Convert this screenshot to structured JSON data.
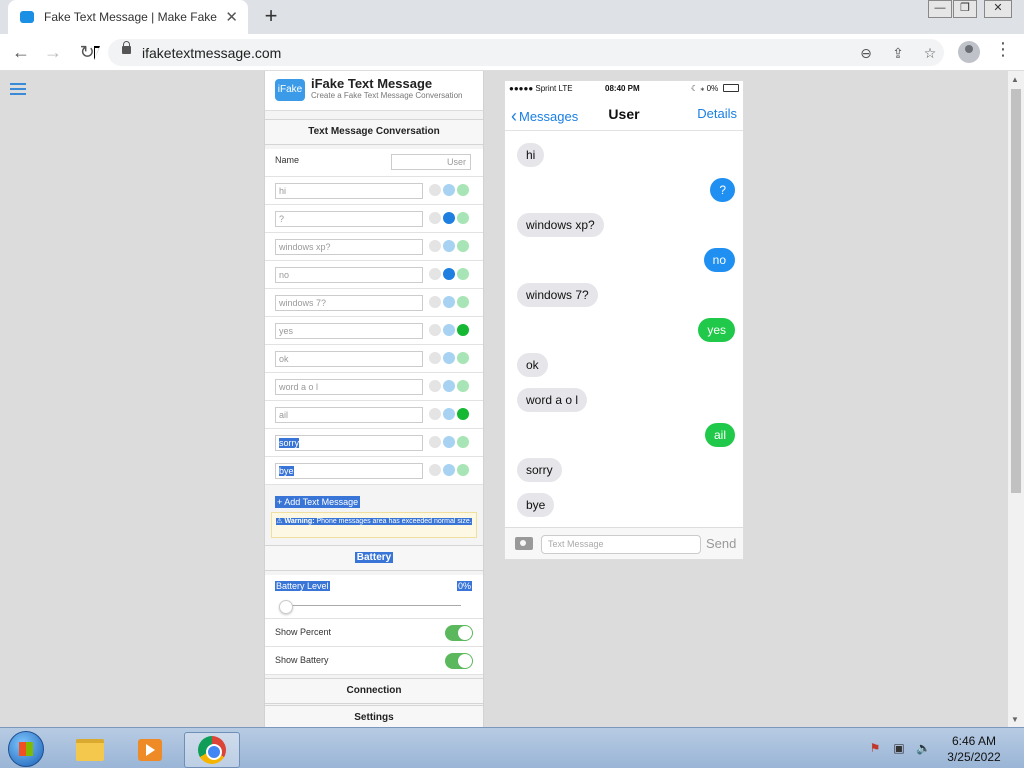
{
  "browser": {
    "tab_title": "Fake Text Message | Make Fake Te",
    "new_tab_label": "+",
    "url": "ifaketextmessage.com"
  },
  "sidebar": {
    "logo_text": "iFake",
    "brand_title": "iFake Text Message",
    "brand_subtitle": "Create a Fake Text Message Conversation",
    "conversation_header": "Text Message Conversation",
    "name_label": "Name",
    "name_value": "User",
    "messages": [
      {
        "text": "hi",
        "selected": false,
        "sender": "them"
      },
      {
        "text": "?",
        "selected": false,
        "sender": "me-blue"
      },
      {
        "text": "windows xp?",
        "selected": false,
        "sender": "them"
      },
      {
        "text": "no",
        "selected": false,
        "sender": "me-blue"
      },
      {
        "text": "windows 7?",
        "selected": false,
        "sender": "them"
      },
      {
        "text": "yes",
        "selected": false,
        "sender": "me-green"
      },
      {
        "text": "ok",
        "selected": false,
        "sender": "them"
      },
      {
        "text": "word a o l",
        "selected": false,
        "sender": "them"
      },
      {
        "text": "ail",
        "selected": false,
        "sender": "me-green"
      },
      {
        "text": "sorry",
        "selected": true,
        "sender": "them"
      },
      {
        "text": "bye",
        "selected": true,
        "sender": "them"
      }
    ],
    "add_message_label": "+ Add Text Message",
    "warning_bold": "⚠ Warning:",
    "warning_text": " Phone messages area has exceeded normal size.",
    "battery_header": "Battery",
    "battery_level_label": "Battery Level",
    "battery_level_value": "0%",
    "battery_level": 0,
    "show_percent_label": "Show Percent",
    "show_percent_on": true,
    "show_battery_label": "Show Battery",
    "show_battery_on": true,
    "connection_header": "Connection",
    "settings_header": "Settings"
  },
  "phone": {
    "carrier": "●●●●● Sprint  LTE",
    "time": "08:40 PM",
    "battery_text": "☾ ⁎  0%",
    "back_label": "Messages",
    "contact": "User",
    "details_label": "Details",
    "bubbles": [
      {
        "text": "hi",
        "style": "gray"
      },
      {
        "text": "?",
        "style": "blue"
      },
      {
        "text": "windows xp?",
        "style": "gray"
      },
      {
        "text": "no",
        "style": "blue"
      },
      {
        "text": "windows 7?",
        "style": "gray"
      },
      {
        "text": "yes",
        "style": "green"
      },
      {
        "text": "ok",
        "style": "gray"
      },
      {
        "text": "word a o l",
        "style": "gray"
      },
      {
        "text": "ail",
        "style": "green"
      },
      {
        "text": "sorry",
        "style": "gray"
      },
      {
        "text": "bye",
        "style": "gray"
      }
    ],
    "composer_placeholder": "Text Message",
    "send_label": "Send"
  },
  "taskbar": {
    "time": "6:46 AM",
    "date": "3/25/2022"
  },
  "colors": {
    "ios_blue": "#1f8ff1",
    "ios_green": "#20c94a",
    "ios_gray": "#e5e5ea",
    "selection": "#3875d7"
  }
}
